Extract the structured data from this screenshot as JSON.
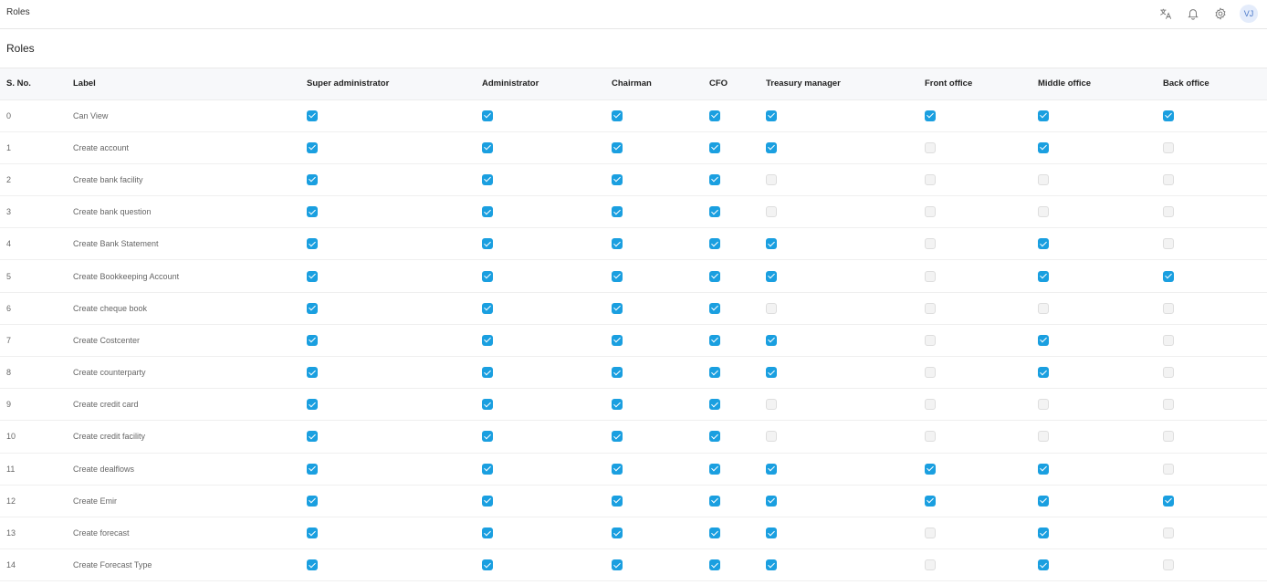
{
  "app": {
    "title": "Roles",
    "avatar_initials": "VJ"
  },
  "topbar_icons": [
    "translate-icon",
    "bell-icon",
    "gear-icon"
  ],
  "page": {
    "title": "Roles"
  },
  "table": {
    "headers": [
      "S. No.",
      "Label",
      "Super administrator",
      "Administrator",
      "Chairman",
      "CFO",
      "Treasury manager",
      "Front office",
      "Middle office",
      "Back office"
    ],
    "rows": [
      {
        "sno": "0",
        "label": "Can View",
        "perms": [
          true,
          true,
          true,
          true,
          true,
          true,
          true,
          true
        ]
      },
      {
        "sno": "1",
        "label": "Create account",
        "perms": [
          true,
          true,
          true,
          true,
          true,
          false,
          true,
          false
        ]
      },
      {
        "sno": "2",
        "label": "Create bank facility",
        "perms": [
          true,
          true,
          true,
          true,
          false,
          false,
          false,
          false
        ]
      },
      {
        "sno": "3",
        "label": "Create bank question",
        "perms": [
          true,
          true,
          true,
          true,
          false,
          false,
          false,
          false
        ]
      },
      {
        "sno": "4",
        "label": "Create Bank Statement",
        "perms": [
          true,
          true,
          true,
          true,
          true,
          false,
          true,
          false
        ]
      },
      {
        "sno": "5",
        "label": "Create Bookkeeping Account",
        "perms": [
          true,
          true,
          true,
          true,
          true,
          false,
          true,
          true
        ]
      },
      {
        "sno": "6",
        "label": "Create cheque book",
        "perms": [
          true,
          true,
          true,
          true,
          false,
          false,
          false,
          false
        ]
      },
      {
        "sno": "7",
        "label": "Create Costcenter",
        "perms": [
          true,
          true,
          true,
          true,
          true,
          false,
          true,
          false
        ]
      },
      {
        "sno": "8",
        "label": "Create counterparty",
        "perms": [
          true,
          true,
          true,
          true,
          true,
          false,
          true,
          false
        ]
      },
      {
        "sno": "9",
        "label": "Create credit card",
        "perms": [
          true,
          true,
          true,
          true,
          false,
          false,
          false,
          false
        ]
      },
      {
        "sno": "10",
        "label": "Create credit facility",
        "perms": [
          true,
          true,
          true,
          true,
          false,
          false,
          false,
          false
        ]
      },
      {
        "sno": "11",
        "label": "Create dealflows",
        "perms": [
          true,
          true,
          true,
          true,
          true,
          true,
          true,
          false
        ]
      },
      {
        "sno": "12",
        "label": "Create Emir",
        "perms": [
          true,
          true,
          true,
          true,
          true,
          true,
          true,
          true
        ]
      },
      {
        "sno": "13",
        "label": "Create forecast",
        "perms": [
          true,
          true,
          true,
          true,
          true,
          false,
          true,
          false
        ]
      },
      {
        "sno": "14",
        "label": "Create Forecast Type",
        "perms": [
          true,
          true,
          true,
          true,
          true,
          false,
          true,
          false
        ]
      }
    ]
  },
  "colors": {
    "accent": "#1a9fe0",
    "checkbox_off": "#f3f3f3",
    "header_bg": "#f7f8fa"
  }
}
